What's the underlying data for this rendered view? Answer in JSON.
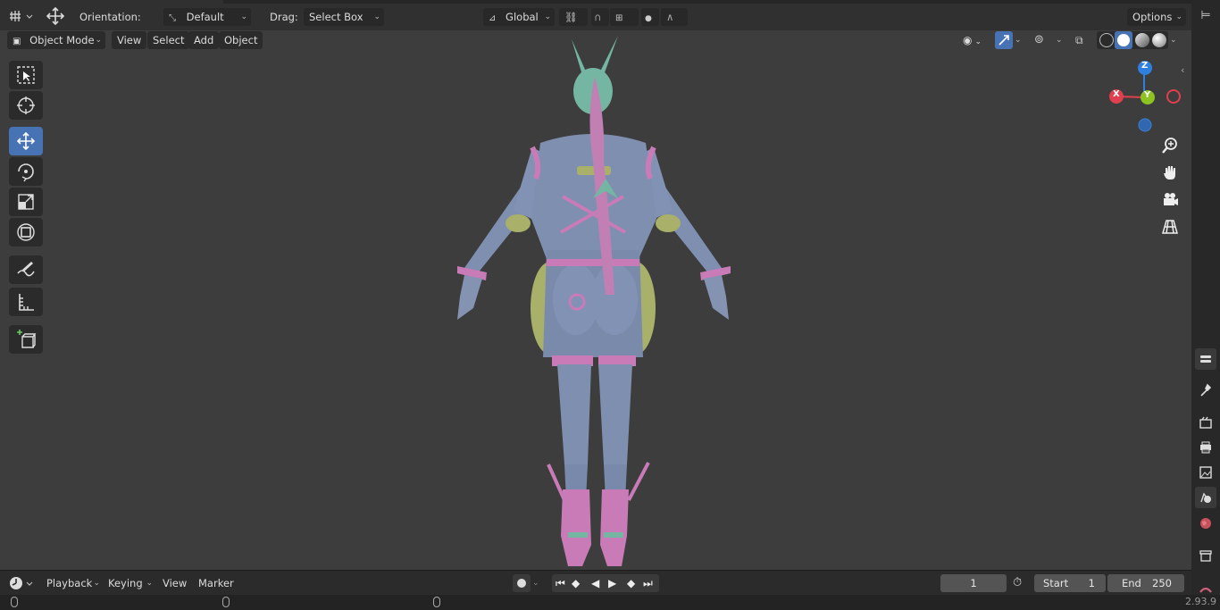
{
  "header": {
    "orientation_label": "Orientation:",
    "orientation_value": "Default",
    "drag_label": "Drag:",
    "drag_value": "Select Box",
    "transform_space": "Global",
    "options_label": "Options"
  },
  "viewport_header": {
    "mode": "Object Mode",
    "menus": [
      "View",
      "Select",
      "Add",
      "Object"
    ]
  },
  "gizmo": {
    "z": "Z",
    "x": "X",
    "y": "Y"
  },
  "toolbar": {
    "tools": [
      "select-box-icon",
      "cursor-icon",
      "move-icon",
      "rotate-icon",
      "scale-icon",
      "transform-icon",
      "annotate-icon",
      "measure-icon",
      "add-cube-icon"
    ],
    "active": "move-icon"
  },
  "timeline": {
    "menus": [
      "Playback",
      "Keying",
      "View",
      "Marker"
    ],
    "current_frame": "1",
    "start_label": "Start",
    "start_value": "1",
    "end_label": "End",
    "end_value": "250"
  },
  "status": {
    "version": "2.93.9"
  },
  "colors": {
    "accent_blue": "#4772b3",
    "model_body": "#7f8fb0",
    "model_trim": "#c97bb8",
    "model_hair": "#c27fb3",
    "model_olive": "#a8b06a",
    "model_teal": "#74b6a2",
    "gizmo_x": "#e0404e",
    "gizmo_y": "#8cc320",
    "gizmo_z": "#2f7fdf"
  }
}
